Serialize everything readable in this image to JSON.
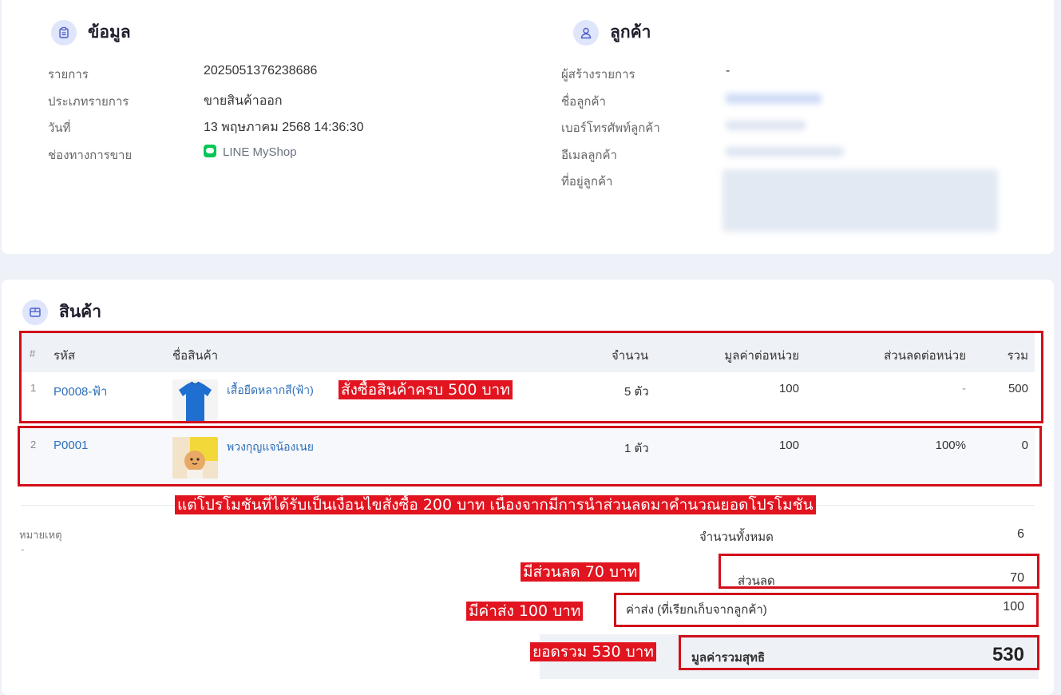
{
  "info": {
    "title": "ข้อมูล",
    "rows": [
      {
        "label": "รายการ",
        "value": "2025051376238686"
      },
      {
        "label": "ประเภทรายการ",
        "value": "ขายสินค้าออก"
      },
      {
        "label": "วันที่",
        "value": "13 พฤษภาคม 2568 14:36:30"
      },
      {
        "label": "ช่องทางการขาย",
        "value": "LINE MyShop"
      }
    ]
  },
  "customer": {
    "title": "ลูกค้า",
    "rows": [
      {
        "label": "ผู้สร้างรายการ",
        "value": "-"
      },
      {
        "label": "ชื่อลูกค้า"
      },
      {
        "label": "เบอร์โทรศัพท์ลูกค้า"
      },
      {
        "label": "อีเมลลูกค้า"
      },
      {
        "label": "ที่อยู่ลูกค้า"
      }
    ]
  },
  "products": {
    "title": "สินค้า",
    "columns": [
      "#",
      "รหัส",
      "ชื่อสินค้า",
      "จำนวน",
      "มูลค่าต่อหน่วย",
      "ส่วนลดต่อหน่วย",
      "รวม"
    ],
    "rows": [
      {
        "index": "1",
        "code": "P0008-ฟ้า",
        "name": "เสื้อยืดหลากสี(ฟ้า)",
        "qty": "5 ตัว",
        "unit_price": "100",
        "unit_discount": "-",
        "total": "500"
      },
      {
        "index": "2",
        "code": "P0001",
        "name": "พวงกุญแจน้องเนย",
        "qty": "1 ตัว",
        "unit_price": "100",
        "unit_discount": "100%",
        "total": "0"
      }
    ]
  },
  "note": {
    "label": "หมายเหตุ",
    "value": "-"
  },
  "summary": {
    "total_qty_label": "จำนวนทั้งหมด",
    "total_qty": "6",
    "discount_label": "ส่วนลด",
    "discount": "70",
    "shipping_label": "ค่าส่ง (ที่เรียกเก็บจากลูกค้า)",
    "shipping": "100",
    "net_label": "มูลค่ารวมสุทธิ",
    "net": "530"
  },
  "annotations": {
    "a1": "สั่งซื้อสินค้าครบ 500 บาท",
    "a2": "แต่โปรโมชันที่ได้รับเป็นเงื่อนไขสั่งซื้อ 200 บาท เนื่องจากมีการนำส่วนลดมาคำนวณยอดโปรโมชัน",
    "a3": "มีส่วนลด 70 บาท",
    "a4": "มีค่าส่ง 100 บาท",
    "a5": "ยอดรวม 530 บาท"
  },
  "colors": {
    "accent": "#2e6fb8",
    "annotation_red": "#e1141f",
    "line_green": "#06c755",
    "page_bg": "#eef1f8"
  }
}
